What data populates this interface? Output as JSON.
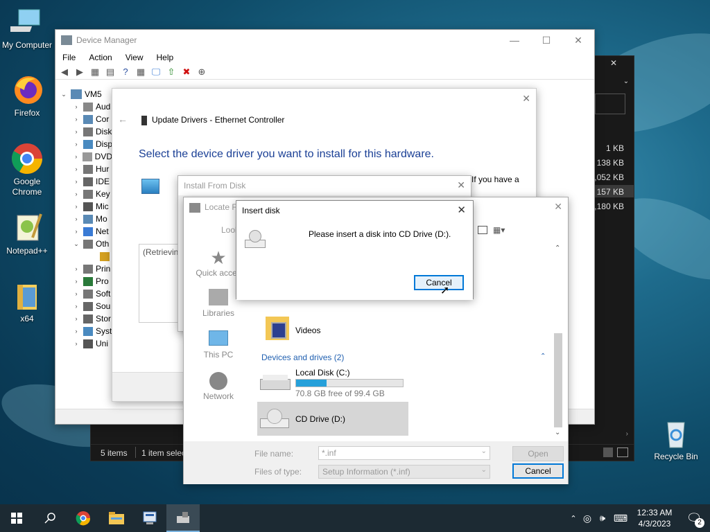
{
  "desktop": {
    "icons": [
      {
        "label": "My Computer",
        "icon": "computer-icon"
      },
      {
        "label": "Firefox",
        "icon": "firefox-icon"
      },
      {
        "label": "Google Chrome",
        "icon": "chrome-icon"
      },
      {
        "label": "Notepad++",
        "icon": "notepadpp-icon"
      },
      {
        "label": "x64",
        "icon": "folder-icon"
      },
      {
        "label": "Recycle Bin",
        "icon": "recycle-bin-icon"
      }
    ]
  },
  "explorer": {
    "sizes": [
      "1 KB",
      "138 KB",
      ",052 KB",
      "157 KB",
      ",180 KB"
    ],
    "status_items": "5 items",
    "status_selected": "1 item selec"
  },
  "device_manager": {
    "title": "Device Manager",
    "menu": [
      "File",
      "Action",
      "View",
      "Help"
    ],
    "root": "VM5",
    "tree": [
      "Aud",
      "Cor",
      "Disk",
      "Disp",
      "DVD",
      "Hur",
      "IDE",
      "Key",
      "Mic",
      "Mo",
      "Net",
      "Oth",
      "",
      "Prin",
      "Pro",
      "Soft",
      "Sou",
      "Stor",
      "Syst",
      "Uni"
    ]
  },
  "update_drivers": {
    "title": "Update Drivers - Ethernet Controller",
    "heading": "Select the device driver you want to install for this hardware.",
    "side_text": "If you have a",
    "retrieving": "(Retrievin"
  },
  "install_from_disk": {
    "title": "Install From Disk"
  },
  "locate_file": {
    "title": "Locate Fi",
    "look_in": "Look",
    "nav": [
      "Quick acces",
      "Libraries",
      "This PC",
      "Network"
    ],
    "videos": "Videos",
    "devices_group": "Devices and drives (2)",
    "local_disk": "Local Disk (C:)",
    "local_disk_free": "70.8 GB free of 99.4 GB",
    "local_disk_used_fraction": 0.288,
    "cd_drive": "CD Drive (D:)",
    "file_name_label": "File name:",
    "file_name_value": "*.inf",
    "file_type_label": "Files of type:",
    "file_type_value": "Setup Information (*.inf)",
    "open_label": "Open",
    "cancel_label": "Cancel"
  },
  "insert_disk": {
    "title": "Insert disk",
    "message": "Please insert a disk into CD Drive (D:).",
    "cancel_label": "Cancel"
  },
  "taskbar": {
    "time": "12:33 AM",
    "date": "4/3/2023",
    "notifications": "2"
  }
}
